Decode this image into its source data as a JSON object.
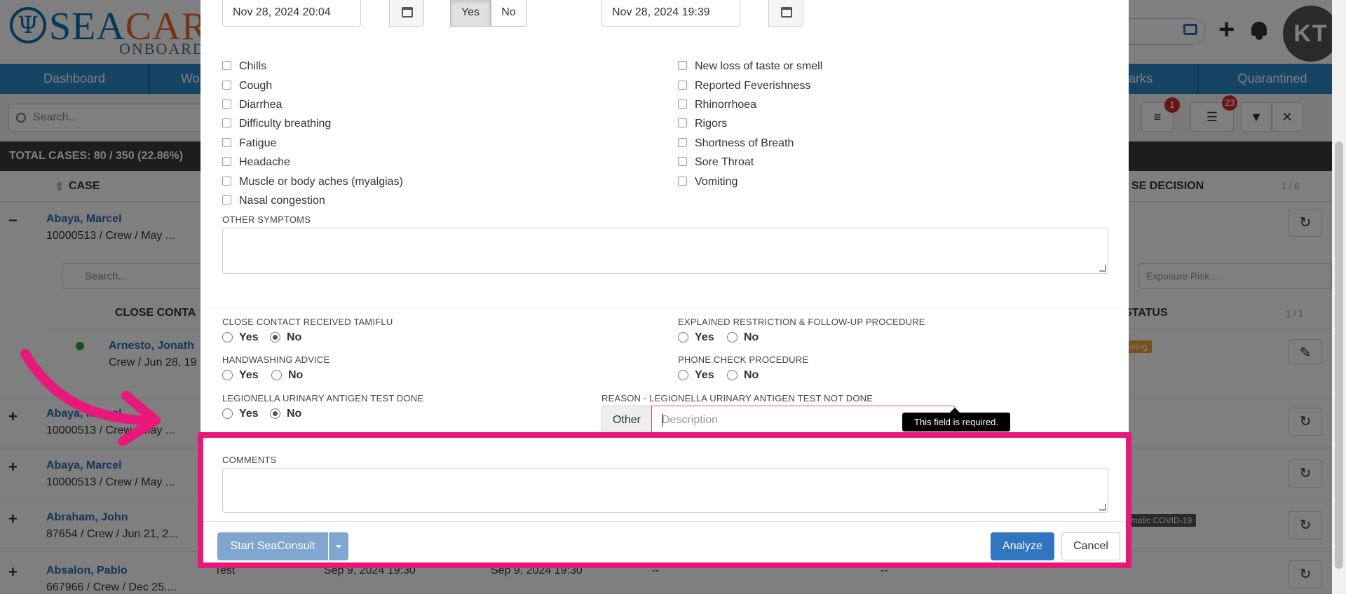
{
  "header": {
    "logo_text_blue": "SEA",
    "logo_text_orange": "CARE",
    "logo_sub": "ONBOARD",
    "avatar_initials": "KT"
  },
  "nav": [
    "Dashboard",
    "Wo",
    "arks",
    "Quarantined"
  ],
  "toolbar": {
    "search_placeholder": "Search...",
    "badge_filters": "1",
    "badge_list": "23"
  },
  "totals": "TOTAL CASES: 80 / 350 (22.86%)",
  "columns": {
    "case": "CASE",
    "case_decision": "SE DECISION",
    "pager": "1 / 6"
  },
  "rows": [
    {
      "toggle": "−",
      "name": "Abaya, Marcel",
      "sub": "10000513 / Crew / May ..."
    },
    {
      "toggle": "+",
      "name": "Abaya, Marcel",
      "sub": "10000513 / Crew / May ..."
    },
    {
      "toggle": "+",
      "name": "Abaya, Marcel",
      "sub": "10000513 / Crew / May ..."
    },
    {
      "toggle": "+",
      "name": "Abraham, John",
      "sub": "87654 / Crew / Jun 21, 2..."
    },
    {
      "toggle": "+",
      "name": "Absalon, Pablo",
      "sub": "667966 / Crew / Dec 25...."
    }
  ],
  "subtable": {
    "search_placeholder": "Search...",
    "header": "CLOSE CONTA",
    "status_header": "STATUS",
    "pager": "1 / 1",
    "exposure_placeholder": "Exposure Risk...",
    "contact_name": "Arnesto, Jonath",
    "contact_sub": "Crew / Jun 28, 19",
    "status_badge": "ering",
    "covid_badge": "omatic COVID-19"
  },
  "background_row_extras": {
    "test_label": "Test",
    "date1": "Sep 9, 2024 19:30",
    "date2": "Sep 9, 2024 19:30",
    "dash1": "--",
    "dash2": "--"
  },
  "modal": {
    "date_left": "Nov 28, 2024 20:04",
    "date_right": "Nov 28, 2024 19:39",
    "seg_yes": "Yes",
    "seg_no": "No",
    "symptoms_left": [
      "Chills",
      "Cough",
      "Diarrhea",
      "Difficulty breathing",
      "Fatigue",
      "Headache",
      "Muscle or body aches (myalgias)",
      "Nasal congestion"
    ],
    "symptoms_right": [
      "New loss of taste or smell",
      "Reported Feverishness",
      "Rhinorrhoea",
      "Rigors",
      "Shortness of Breath",
      "Sore Throat",
      "Vomiting"
    ],
    "other_symptoms_label": "OTHER SYMPTOMS",
    "q_tamiflu": "CLOSE CONTACT RECEIVED TAMIFLU",
    "q_restriction": "EXPLAINED RESTRICTION & FOLLOW-UP PROCEDURE",
    "q_handwashing": "HANDWASHING ADVICE",
    "q_phone": "PHONE CHECK PROCEDURE",
    "q_legionella": "LEGIONELLA URINARY ANTIGEN TEST DONE",
    "q_reason": "REASON - LEGIONELLA URINARY ANTIGEN TEST NOT DONE",
    "radio_yes": "Yes",
    "radio_no": "No",
    "addon_other": "Other",
    "description_placeholder": "Description",
    "tooltip": "This field is required.",
    "comments_label": "COMMENTS",
    "btn_start": "Start SeaConsult",
    "btn_analyze": "Analyze",
    "btn_cancel": "Cancel"
  },
  "colors": {
    "highlight": "#e8187a",
    "brand_blue": "#2b88c8",
    "primary": "#2f75bf"
  }
}
